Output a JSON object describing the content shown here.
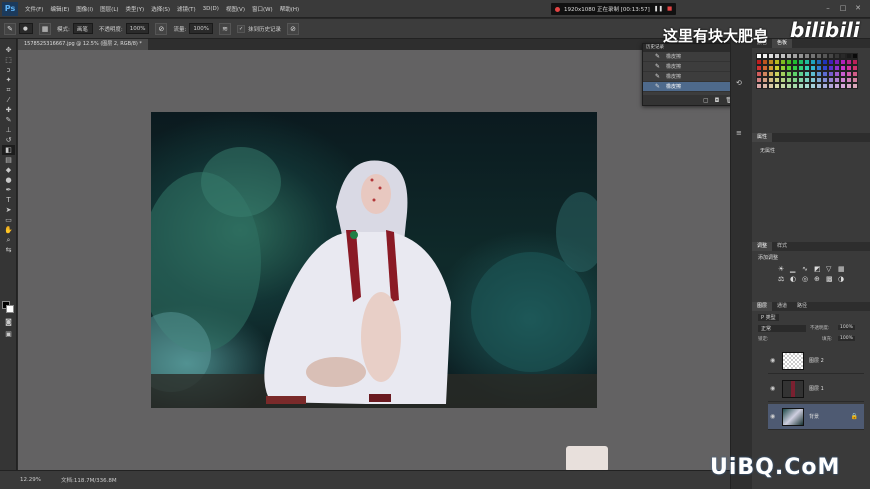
{
  "app": {
    "logo": "Ps",
    "menu": [
      "文件(F)",
      "编辑(E)",
      "图像(I)",
      "图层(L)",
      "类型(Y)",
      "选择(S)",
      "滤镜(T)",
      "3D(D)",
      "视图(V)",
      "窗口(W)",
      "帮助(H)"
    ]
  },
  "recording": {
    "text": "1920x1080 正在录制 [00:13:57]"
  },
  "options": {
    "mode_label": "模式:",
    "mode_value": "画笔",
    "opacity_label": "不透明度:",
    "opacity_value": "100%",
    "flow_label": "流量:",
    "flow_value": "100%",
    "history_label": "抹到历史记录"
  },
  "document": {
    "tab": "1578525316667.jpg @ 12.5% (图层 2, RGB/8) *",
    "zoom": "12.29%",
    "doc_size": "文档:118.7M/336.8M"
  },
  "history": {
    "title": "历史记录",
    "items": [
      "橡皮擦",
      "橡皮擦",
      "橡皮擦",
      "橡皮擦"
    ]
  },
  "right": {
    "swatch_tabs": [
      "颜色",
      "色板"
    ],
    "properties_tabs": [
      "属性"
    ],
    "properties_text": "无属性",
    "adjust_tabs": [
      "调整",
      "样式"
    ],
    "adjust_label": "添加调整",
    "layers_tabs": [
      "图层",
      "通道",
      "路径"
    ],
    "kind_label": "P 类型",
    "blend_mode": "正常",
    "opacity_label": "不透明度:",
    "opacity_value": "100%",
    "lock_label": "锁定:",
    "fill_label": "填充:",
    "fill_value": "100%",
    "layers": [
      "图层 2",
      "图层 1",
      "背景"
    ]
  },
  "watermark": {
    "top": "这里有块大肥皂",
    "brand": "bilibili",
    "bottom": "UiBQ.CoM"
  },
  "colors": {
    "selection_blue": "#4e6a8c",
    "accent_red": "#e24444"
  }
}
